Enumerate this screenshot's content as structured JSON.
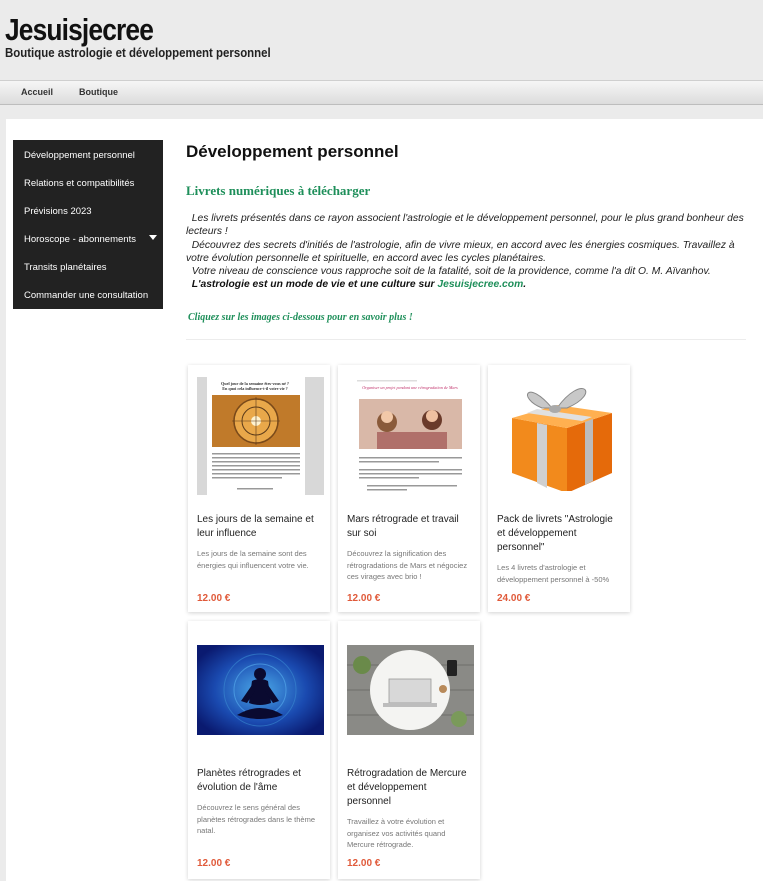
{
  "header": {
    "title": "Jesuisjecree",
    "subtitle": "Boutique astrologie et développement personnel"
  },
  "nav": [
    {
      "label": "Accueil"
    },
    {
      "label": "Boutique"
    }
  ],
  "sidebar": {
    "items": [
      {
        "label": "Développement personnel"
      },
      {
        "label": "Relations et compatibilités"
      },
      {
        "label": "Prévisions 2023"
      },
      {
        "label": "Horoscope - abonnements"
      },
      {
        "label": "Transits planétaires"
      },
      {
        "label": "Commander une consultation"
      }
    ]
  },
  "main": {
    "title": "Développement personnel",
    "section_title": "Livrets numériques à télécharger",
    "intro": {
      "p1": "Les livrets présentés dans ce rayon associent l'astrologie et le développement personnel, pour le plus grand bonheur des lecteurs !",
      "p2": "Découvrez des secrets d'initiés de l'astrologie, afin de vivre mieux, en accord avec les énergies cosmiques. Travaillez à votre évolution personnelle et spirituelle, en accord avec les cycles planétaires.",
      "p3": "Votre niveau de conscience vous rapproche soit de la fatalité, soit de la providence, comme l'a dit O. M. Aïvanhov.",
      "p4_strong": "L'astrologie est un mode de vie et une culture sur ",
      "p4_link": "Jesuisjecree.com",
      "p4_end": "."
    },
    "cta": "Cliquez sur les images ci-dessous pour en savoir plus !"
  },
  "products": [
    {
      "name": "Les jours de la semaine et leur influence",
      "desc": "Les jours de la semaine sont des énergies qui influencent votre vie.",
      "price": "12.00 €"
    },
    {
      "name": "Mars rétrograde et travail sur soi",
      "desc": "Découvrez la signification des rétrogradations de Mars et négociez ces virages avec brio !",
      "price": "12.00 €"
    },
    {
      "name": "Pack de livrets \"Astrologie et développement personnel\"",
      "desc": "Les 4 livrets d'astrologie et développement personnel à -50%",
      "price": "24.00 €"
    },
    {
      "name": "Planètes rétrogrades et évolution de l'âme",
      "desc": "Découvrez le sens général des planètes rétrogrades dans le thème natal.",
      "price": "12.00 €"
    },
    {
      "name": "Rétrogradation de Mercure et développement personnel",
      "desc": "Travaillez à votre évolution et organisez vos activités quand Mercure rétrograde.",
      "price": "12.00 €"
    }
  ],
  "thumb_text": {
    "p1_heading": "Quel jour de la semaine êtes-vous né ?\nEn quoi cela influence-t-il votre vie ?",
    "p2_heading": "Organiser un projet pendant une rétrogradation de Mars"
  },
  "colors": {
    "accent": "#1e8f5a",
    "price": "#e05a3a",
    "sidebar": "#222222"
  }
}
